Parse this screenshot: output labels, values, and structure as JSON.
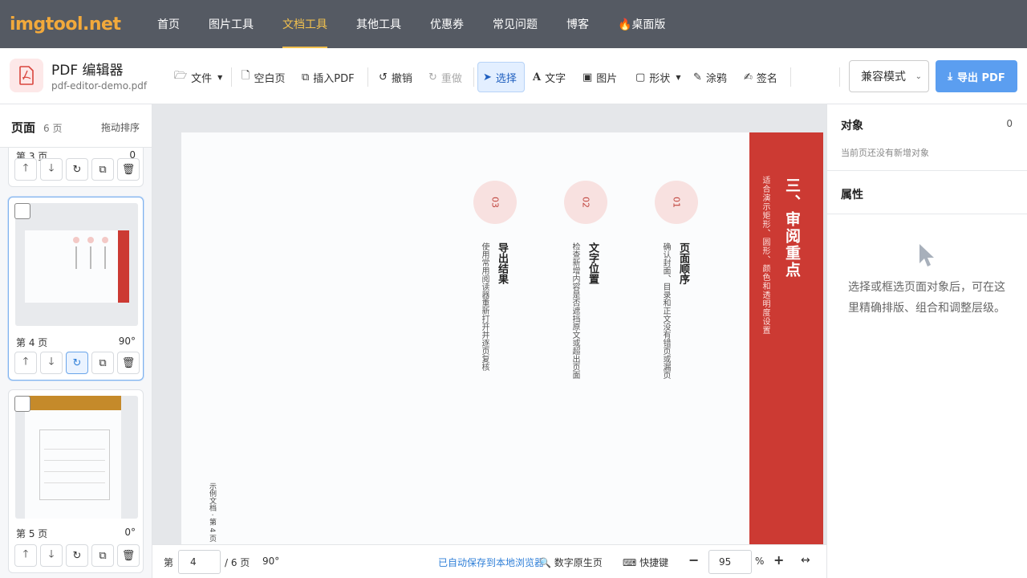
{
  "nav": {
    "logo": "imgtool.net",
    "items": [
      "首页",
      "图片工具",
      "文档工具",
      "其他工具",
      "优惠券",
      "常见问题",
      "博客",
      "🔥桌面版"
    ],
    "active_index": 2
  },
  "toolbar": {
    "app_title": "PDF 编辑器",
    "file_name": "pdf-editor-demo.pdf",
    "file": "文件",
    "blank_page": "空白页",
    "insert_pdf": "插入PDF",
    "undo": "撤销",
    "redo": "重做",
    "select": "选择",
    "text": "文字",
    "image": "图片",
    "shape": "形状",
    "draw": "涂鸦",
    "sign": "签名",
    "mode": "兼容模式",
    "export": "导出 PDF"
  },
  "sidebar": {
    "title": "页面",
    "count": "6 页",
    "sort": "拖动排序",
    "pages": [
      {
        "label": "第 3 页",
        "rotation": "0"
      },
      {
        "label": "第 4 页",
        "rotation": "90°"
      },
      {
        "label": "第 5 页",
        "rotation": "0°"
      }
    ]
  },
  "document": {
    "heading": "三、审阅重点",
    "subheading": "适合演示矩形、圆形、颜色和透明度设置",
    "items": [
      {
        "num": "01",
        "title": "页面顺序",
        "desc": "确认封面、目录和正文没有错页或漏页"
      },
      {
        "num": "02",
        "title": "文字位置",
        "desc": "检查新增内容是否遮挡原文或超出页面"
      },
      {
        "num": "03",
        "title": "导出结果",
        "desc": "使用常用阅读器重新打开并逐页复核"
      }
    ],
    "footer": "示例文档 · 第 4 页"
  },
  "status": {
    "page_prefix": "第",
    "page_value": "4",
    "page_total": "/ 6 页",
    "rotation": "90°",
    "autosave": "已自动保存到本地浏览器",
    "native_page": "数字原生页",
    "shortcuts": "快捷键",
    "zoom_value": "95",
    "zoom_unit": "%"
  },
  "rpanel": {
    "objects_title": "对象",
    "objects_count": "0",
    "objects_hint": "当前页还没有新增对象",
    "props_title": "属性",
    "props_hint": "选择或框选页面对象后，可在这里精确排版、组合和调整层级。"
  },
  "colors": {
    "nav_bg": "#555a63",
    "logo": "#f2a93b",
    "nav_active": "#f2c14e",
    "accent_blue": "#5b9ef0",
    "doc_red": "#cc3a33"
  }
}
